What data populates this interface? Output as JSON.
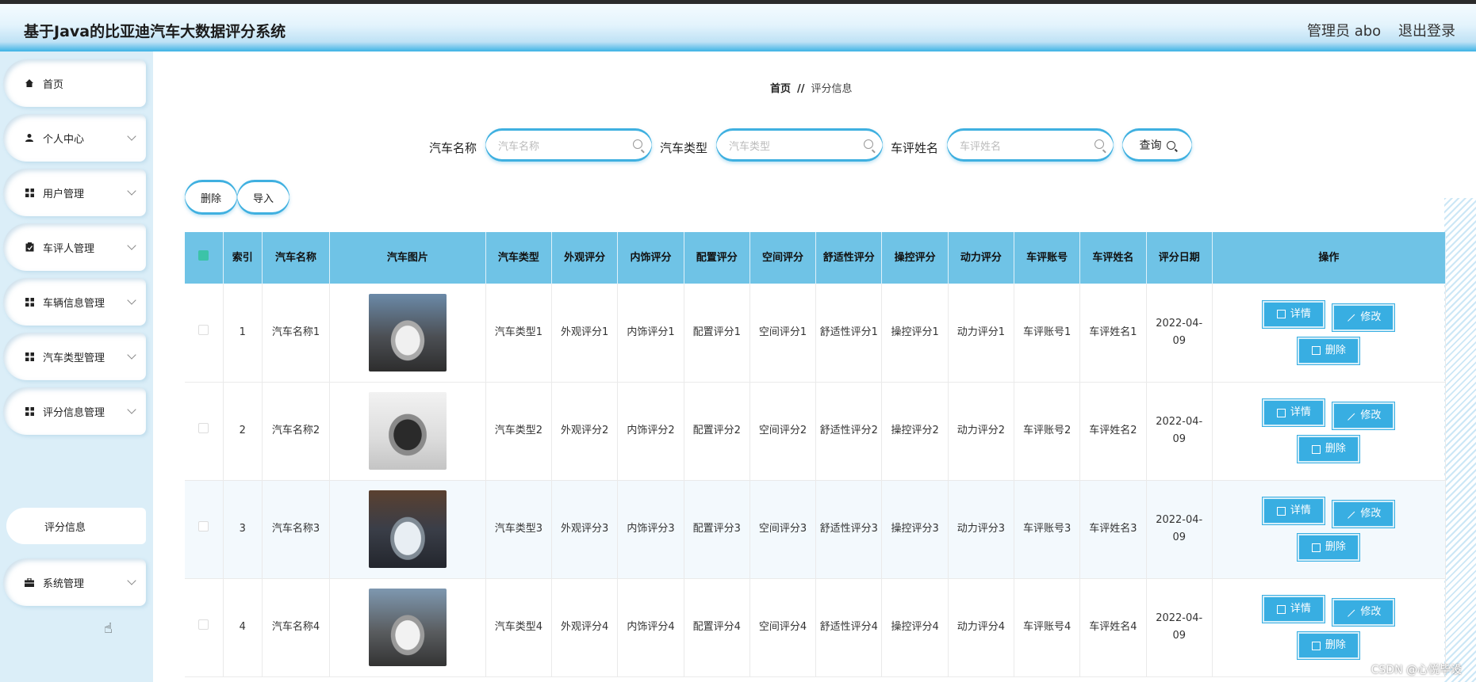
{
  "header": {
    "title": "基于Java的比亚迪汽车大数据评分系统",
    "user": "管理员 abo",
    "logout": "退出登录"
  },
  "sidebar": {
    "items": [
      {
        "label": "首页",
        "icon": "home-icon"
      },
      {
        "label": "个人中心",
        "icon": "user-icon"
      },
      {
        "label": "用户管理",
        "icon": "grid-icon"
      },
      {
        "label": "车评人管理",
        "icon": "clipboard-icon"
      },
      {
        "label": "车辆信息管理",
        "icon": "grid-icon"
      },
      {
        "label": "汽车类型管理",
        "icon": "grid-icon"
      },
      {
        "label": "评分信息管理",
        "icon": "grid-icon"
      },
      {
        "label": "系统管理",
        "icon": "briefcase-icon"
      }
    ],
    "submenu": {
      "label": "评分信息"
    }
  },
  "breadcrumb": {
    "home": "首页",
    "sep": "//",
    "current": "评分信息"
  },
  "search": {
    "car_name_label": "汽车名称",
    "car_name_placeholder": "汽车名称",
    "car_type_label": "汽车类型",
    "car_type_placeholder": "汽车类型",
    "reviewer_label": "车评姓名",
    "reviewer_placeholder": "车评姓名",
    "query_label": "查询"
  },
  "toolbar": {
    "delete_label": "删除",
    "import_label": "导入"
  },
  "table": {
    "columns": [
      "索引",
      "汽车名称",
      "汽车图片",
      "汽车类型",
      "外观评分",
      "内饰评分",
      "配置评分",
      "空间评分",
      "舒适性评分",
      "操控评分",
      "动力评分",
      "车评账号",
      "车评姓名",
      "评分日期",
      "操作"
    ],
    "rows": [
      {
        "index": "1",
        "name": "汽车名称1",
        "type": "汽车类型1",
        "exterior": "外观评分1",
        "interior": "内饰评分1",
        "config": "配置评分1",
        "space": "空间评分1",
        "comfort": "舒适性评分1",
        "handling": "操控评分1",
        "power": "动力评分1",
        "account": "车评账号1",
        "reviewer": "车评姓名1",
        "date": "2022-04-09"
      },
      {
        "index": "2",
        "name": "汽车名称2",
        "type": "汽车类型2",
        "exterior": "外观评分2",
        "interior": "内饰评分2",
        "config": "配置评分2",
        "space": "空间评分2",
        "comfort": "舒适性评分2",
        "handling": "操控评分2",
        "power": "动力评分2",
        "account": "车评账号2",
        "reviewer": "车评姓名2",
        "date": "2022-04-09"
      },
      {
        "index": "3",
        "name": "汽车名称3",
        "type": "汽车类型3",
        "exterior": "外观评分3",
        "interior": "内饰评分3",
        "config": "配置评分3",
        "space": "空间评分3",
        "comfort": "舒适性评分3",
        "handling": "操控评分3",
        "power": "动力评分3",
        "account": "车评账号3",
        "reviewer": "车评姓名3",
        "date": "2022-04-09"
      },
      {
        "index": "4",
        "name": "汽车名称4",
        "type": "汽车类型4",
        "exterior": "外观评分4",
        "interior": "内饰评分4",
        "config": "配置评分4",
        "space": "空间评分4",
        "comfort": "舒适性评分4",
        "handling": "操控评分4",
        "power": "动力评分4",
        "account": "车评账号4",
        "reviewer": "车评姓名4",
        "date": "2022-04-09"
      }
    ],
    "actions": {
      "detail": "详情",
      "edit": "修改",
      "delete": "删除"
    }
  },
  "watermark": "CSDN @心悦毕设",
  "colors": {
    "accent": "#38aee2",
    "header_th": "#6fc3e6",
    "check_head": "#3cc3a8"
  }
}
